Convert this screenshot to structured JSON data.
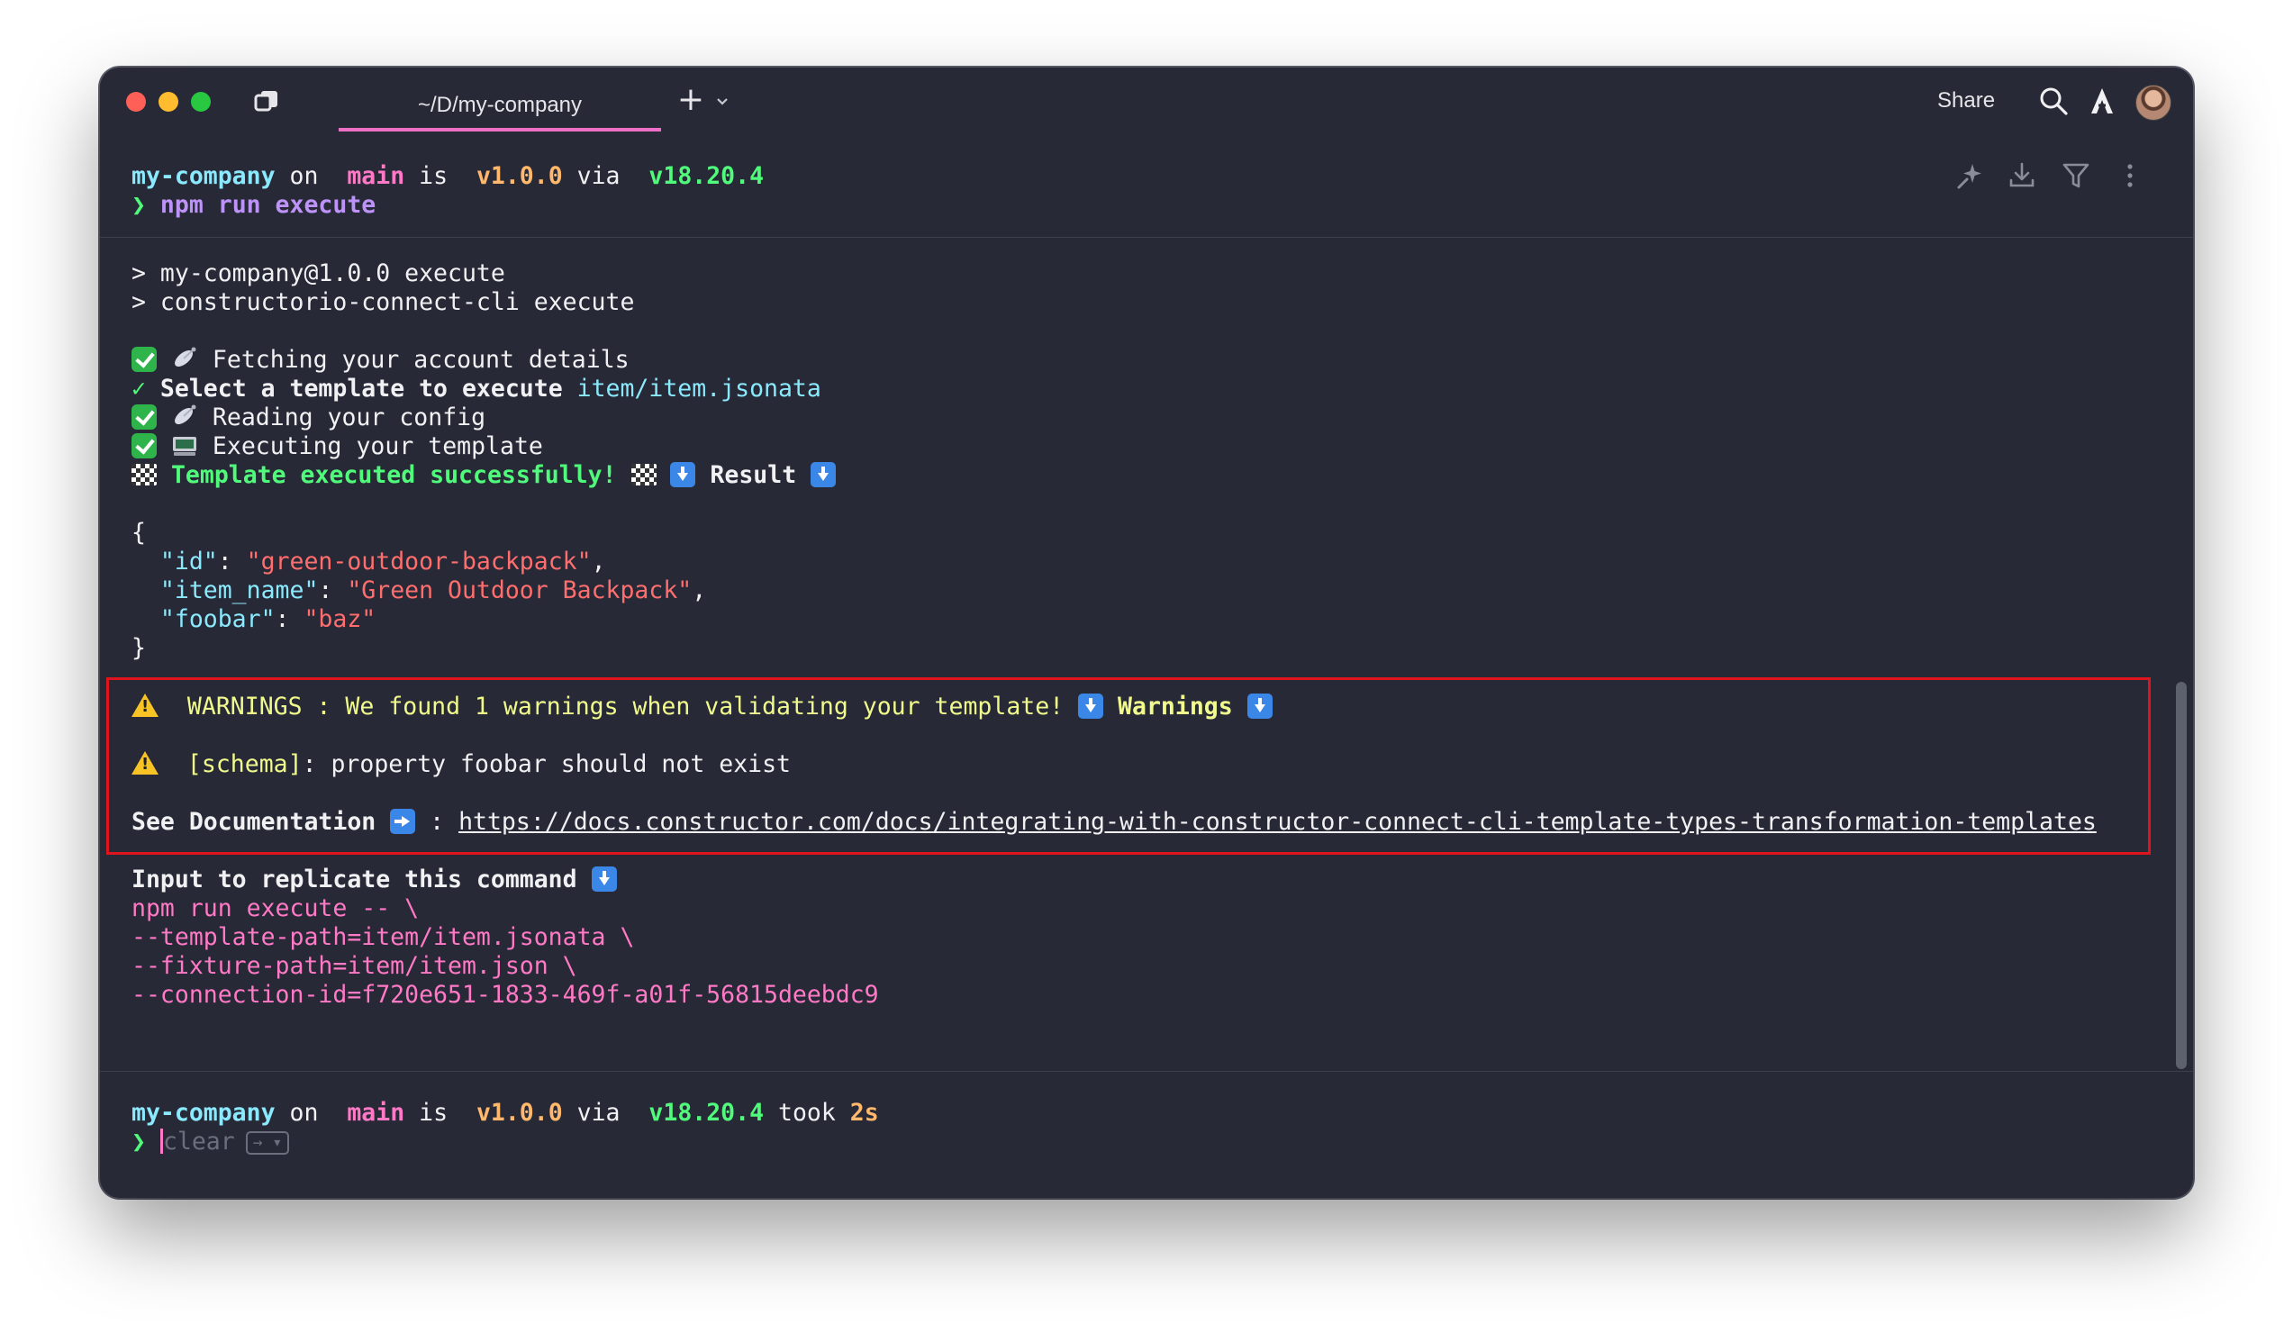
{
  "titlebar": {
    "tab_title": "~/D/my-company",
    "share_label": "Share"
  },
  "prompt1": {
    "dir": "my-company",
    "on": " on ",
    "branch": " main",
    "is": " is ",
    "version": " v1.0.0",
    "via": " via ",
    "node": " v18.20.4",
    "arrow": "❯",
    "command": " npm run execute"
  },
  "output": {
    "npm_line1": "> my-company@1.0.0 execute",
    "npm_line2": "> constructorio-connect-cli execute",
    "fetch": " Fetching your account details",
    "select_check": "✓",
    "select_text": " Select a template to execute",
    "select_value": " item/item.jsonata",
    "reading": " Reading your config",
    "executing": " Executing your template",
    "success": " Template executed successfully! ",
    "result": " Result ",
    "json_open": "{",
    "json_id_key": "  \"id\"",
    "json_id_val": "\"green-outdoor-backpack\"",
    "json_name_key": "  \"item_name\"",
    "json_name_val": "\"Green Outdoor Backpack\"",
    "json_foobar_key": "  \"foobar\"",
    "json_foobar_val": "\"baz\"",
    "json_close": "}",
    "warnings_text": "WARNINGS : We found 1 warnings when validating your template! ",
    "warnings_label": " Warnings ",
    "schema_tag": "[schema]",
    "schema_text": ": property foobar should not exist",
    "see_docs": "See Documentation ",
    "docs_colon": " : ",
    "docs_url": "https://docs.constructor.com/docs/integrating-with-constructor-connect-cli-template-types-transformation-templates",
    "replicate": "Input to replicate this command ",
    "cmd1": "npm run execute -- \\",
    "cmd2": "--template-path=item/item.jsonata \\",
    "cmd3": "--fixture-path=item/item.json \\",
    "cmd4": "--connection-id=f720e651-1833-469f-a01f-56815deebdc9"
  },
  "prompt2": {
    "dir": "my-company",
    "on": " on ",
    "branch": " main",
    "is": " is ",
    "version": " v1.0.0",
    "via": " via ",
    "node": " v18.20.4",
    "took": " took ",
    "duration": "2s",
    "arrow": "❯",
    "suggestion": "clear",
    "hint": "→ ▾"
  },
  "icons": {
    "toolbar": [
      "panel-icon",
      "plus-icon",
      "chevron-down-icon",
      "search-icon",
      "warp-logo-icon",
      "avatar"
    ],
    "block": [
      "ai-sparkle-icon",
      "download-icon",
      "filter-icon",
      "more-vertical-icon"
    ]
  },
  "colors": {
    "background": "#272936",
    "tab_underline": "#ee70c6",
    "warning_border": "#e0141c",
    "cyan": "#8be9fd",
    "pink": "#ff79c6",
    "orange": "#ffb86c",
    "green": "#50fa7b",
    "string_red": "#ff6e6e",
    "warning_yellow": "#f1fa8c"
  }
}
